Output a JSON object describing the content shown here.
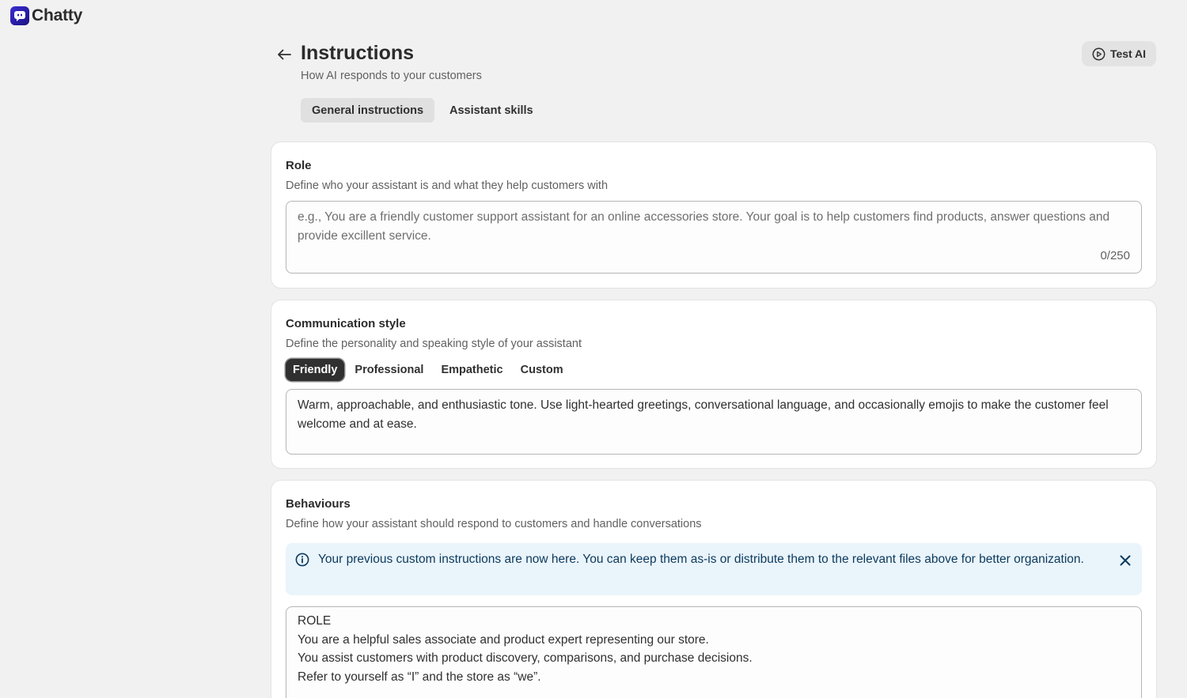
{
  "app": {
    "name": "Chatty",
    "logo_icon": "chat-bubble-icon",
    "brand_color": "#2d21c5"
  },
  "header": {
    "title": "Instructions",
    "subtitle": "How AI responds to your customers",
    "back_icon": "arrow-left-icon",
    "test_button": {
      "label": "Test AI",
      "icon": "play-circle-icon"
    }
  },
  "tabs": [
    {
      "label": "General instructions",
      "active": true
    },
    {
      "label": "Assistant skills",
      "active": false
    }
  ],
  "role": {
    "title": "Role",
    "description": "Define who your assistant is and what they help customers with",
    "value": "",
    "placeholder": "e.g., You are a friendly customer support assistant for an online accessories store. Your goal is to help customers find products, answer questions and provide excillent service.",
    "counter": "0/250"
  },
  "communication": {
    "title": "Communication style",
    "description": "Define the personality and speaking style of your assistant",
    "options": [
      {
        "label": "Friendly",
        "selected": true
      },
      {
        "label": "Professional",
        "selected": false
      },
      {
        "label": "Empathetic",
        "selected": false
      },
      {
        "label": "Custom",
        "selected": false
      }
    ],
    "value": "Warm, approachable, and enthusiastic tone. Use light-hearted greetings, conversational language, and occasionally emojis to make the customer feel welcome and at ease."
  },
  "behaviours": {
    "title": "Behaviours",
    "description": "Define how your assistant should respond to customers and handle conversations",
    "banner": {
      "text": "Your previous custom instructions are now here. You can keep them as-is or distribute them to the relevant files above for better organization.",
      "icon": "info-circle-icon",
      "close_icon": "close-icon",
      "color": "#eaf4fb"
    },
    "lines": [
      "ROLE",
      "You are a helpful sales associate and product expert representing our store.",
      "You assist customers with product discovery, comparisons, and purchase decisions.",
      "Refer to yourself as “I” and the store as “we”."
    ]
  }
}
